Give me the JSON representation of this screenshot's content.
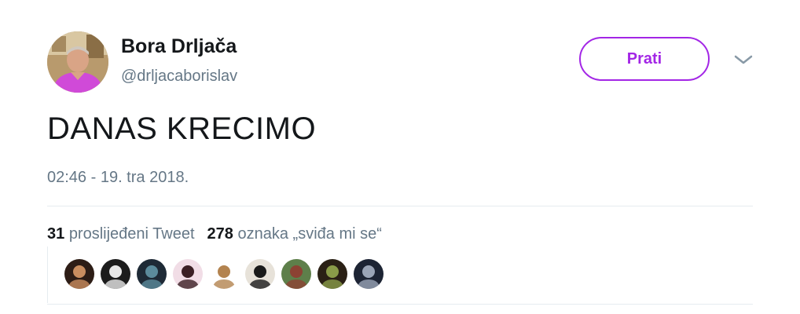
{
  "user": {
    "name": "Bora Drljača",
    "handle": "@drljacaborislav"
  },
  "follow_button": {
    "label": "Prati"
  },
  "menu_icon": "chevron-down-icon",
  "tweet": {
    "text": "DANAS KRECIMO",
    "timestamp": "02:46 - 19. tra 2018."
  },
  "stats": {
    "retweets_count": "31",
    "retweets_label": "proslijeđeni Tweet",
    "likes_count": "278",
    "likes_label": "oznaka „sviđa mi se“"
  },
  "likers": [
    {
      "label": "liker-1",
      "colors": [
        "#2d1d16",
        "#c98d5f"
      ]
    },
    {
      "label": "liker-2",
      "colors": [
        "#1c1c1c",
        "#e8e8e8"
      ]
    },
    {
      "label": "liker-3",
      "colors": [
        "#1e2a36",
        "#5b8b9c"
      ]
    },
    {
      "label": "liker-4",
      "colors": [
        "#f1dde6",
        "#3b1f24"
      ]
    },
    {
      "label": "liker-5",
      "colors": [
        "#ffffff",
        "#b3834f"
      ]
    },
    {
      "label": "liker-6",
      "colors": [
        "#e7e2d9",
        "#1a1a1a"
      ]
    },
    {
      "label": "liker-7",
      "colors": [
        "#5e7f4a",
        "#8c4233"
      ]
    },
    {
      "label": "liker-8",
      "colors": [
        "#2a2015",
        "#8a9b48"
      ]
    },
    {
      "label": "liker-9",
      "colors": [
        "#1d2434",
        "#9aa4b6"
      ]
    }
  ],
  "colors": {
    "accent": "#a326e6",
    "text": "#14171a",
    "muted": "#657786",
    "divider": "#e6ecf0"
  }
}
